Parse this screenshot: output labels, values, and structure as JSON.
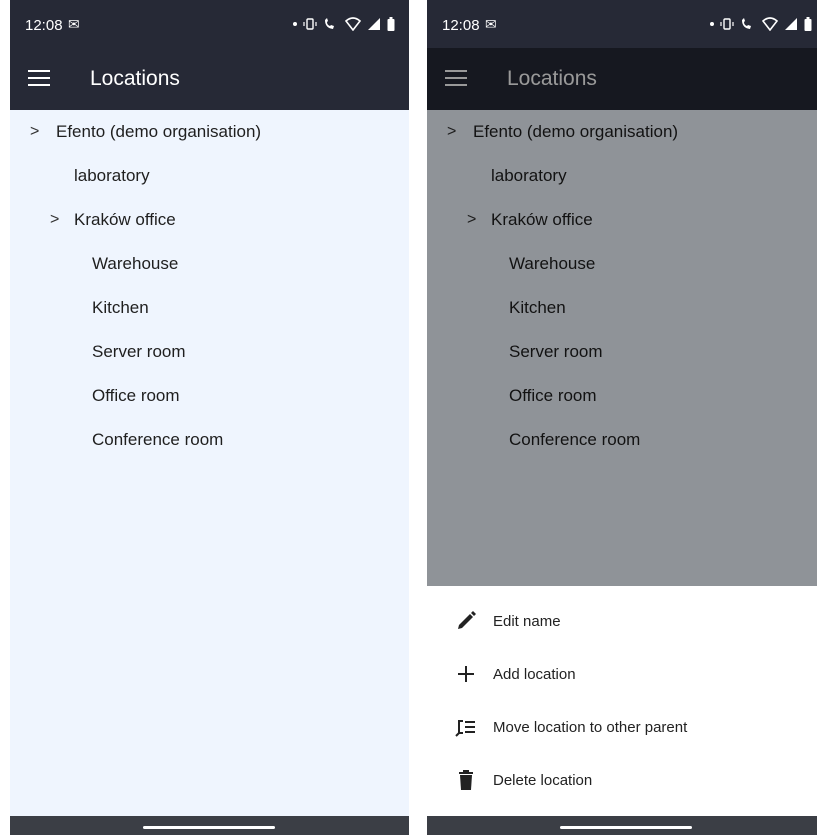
{
  "status": {
    "time": "12:08",
    "mail_icon": "gmail-icon"
  },
  "app_bar": {
    "title": "Locations"
  },
  "tree": {
    "root": "Efento (demo organisation)",
    "level1": [
      "laboratory",
      "Kraków office"
    ],
    "level2": [
      "Warehouse",
      "Kitchen",
      "Server room",
      "Office room",
      "Conference room"
    ]
  },
  "sheet": {
    "edit_name": "Edit name",
    "add_location": "Add location",
    "move_location": "Move location to other parent",
    "delete_location": "Delete location"
  },
  "colors": {
    "app_bar": "#262936",
    "list_bg": "#eff5fe",
    "nav_bar": "#3b3e45"
  }
}
